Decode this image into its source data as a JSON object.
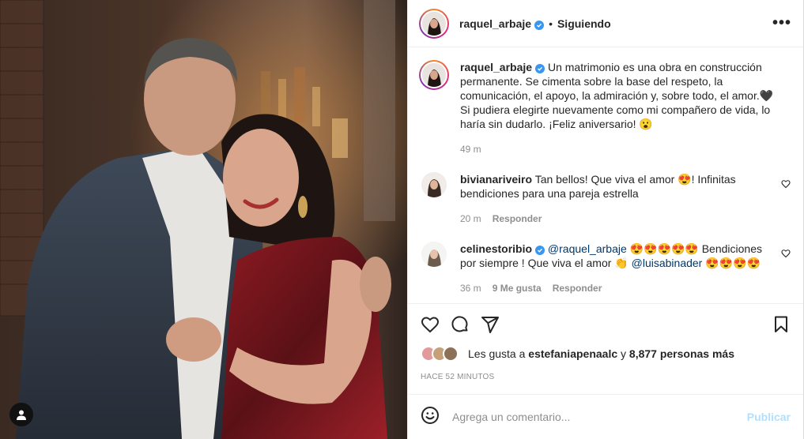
{
  "photo": {
    "alt_icon": "user-tag-icon"
  },
  "header": {
    "username": "raquel_arbaje",
    "separator": "•",
    "follow_state": "Siguiendo",
    "more_icon": "•••"
  },
  "caption": {
    "username": "raquel_arbaje",
    "text": "Un matrimonio es una obra en construcción permanente. Se cimenta sobre la base del respeto, la comunicación, el apoyo, la admiración y, sobre todo, el amor.🖤 Si pudiera elegirte nuevamente como mi compañero de vida, lo haría sin dudarlo. ¡Feliz aniversario! 😮",
    "time": "49 m"
  },
  "comments": [
    {
      "username": "bivianariveiro",
      "text": "Tan bellos! Que viva el amor 😍! Infinitas bendiciones para una pareja estrella",
      "time": "20 m",
      "reply": "Responder"
    },
    {
      "username": "celinestoribio",
      "mention1": "@raquel_arbaje",
      "text_a": "😍😍😍😍😍 Bendiciones por siempre ! Que viva el amor 👏",
      "mention2": "@luisabinader",
      "text_b": "😍😍😍😍",
      "time": "36 m",
      "likes": "9 Me gusta",
      "reply": "Responder"
    }
  ],
  "likes": {
    "prefix": "Les gusta a",
    "user": "estefaniapenaalc",
    "connector": "y",
    "count": "8,877 personas más"
  },
  "time_ago": "HACE 52 MINUTOS",
  "add_comment": {
    "placeholder": "Agrega un comentario...",
    "publish_label": "Publicar"
  },
  "colors": {
    "verified": "#3897f0",
    "publish_disabled": "#b2dffc",
    "meta_text": "#8e8e8e"
  }
}
